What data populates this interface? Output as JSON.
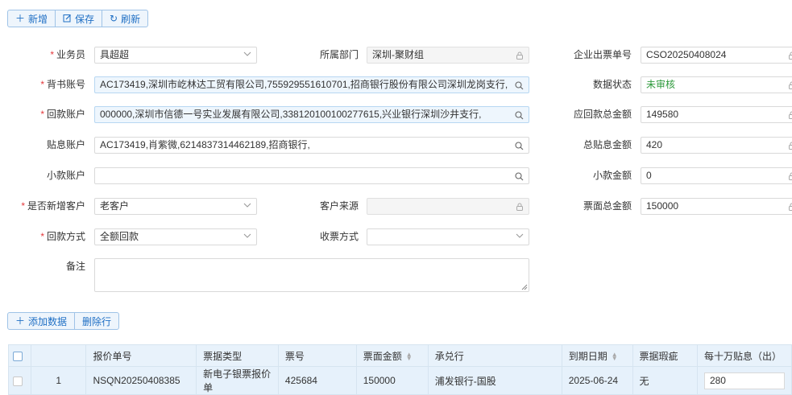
{
  "toolbar": {
    "add": "新增",
    "save": "保存",
    "refresh": "刷新"
  },
  "form": {
    "salesman": {
      "label": "业务员",
      "value": "具超超"
    },
    "department": {
      "label": "所属部门",
      "value": "深圳-聚财组"
    },
    "ticket_no": {
      "label": "企业出票单号",
      "value": "CSO20250408024"
    },
    "endorse_account": {
      "label": "背书账号",
      "value": "AC173419,深圳市屹林达工贸有限公司,755929551610701,招商银行股份有限公司深圳龙岗支行,"
    },
    "data_status": {
      "label": "数据状态",
      "value": "未审核"
    },
    "return_account": {
      "label": "回款账户",
      "value": "000000,深圳市信德一号实业发展有限公司,338120100100277615,兴业银行深圳沙井支行,"
    },
    "receivable_total": {
      "label": "应回款总金额",
      "value": "149580"
    },
    "discount_account": {
      "label": "贴息账户",
      "value": "AC173419,肖紫微,6214837314462189,招商银行,"
    },
    "discount_total": {
      "label": "总贴息金额",
      "value": "420"
    },
    "small_account": {
      "label": "小款账户",
      "value": ""
    },
    "small_amount": {
      "label": "小款金额",
      "value": "0"
    },
    "new_customer": {
      "label": "是否新增客户",
      "value": "老客户"
    },
    "customer_source": {
      "label": "客户来源",
      "value": ""
    },
    "face_total": {
      "label": "票面总金额",
      "value": "150000"
    },
    "return_method": {
      "label": "回款方式",
      "value": "全额回款"
    },
    "receive_method": {
      "label": "收票方式",
      "value": ""
    },
    "remark": {
      "label": "备注",
      "value": ""
    }
  },
  "rows_toolbar": {
    "add": "添加数据",
    "delete": "删除行"
  },
  "table": {
    "headers": [
      "",
      "",
      "报价单号",
      "票据类型",
      "票号",
      "票面金额",
      "承兑行",
      "到期日期",
      "票据瑕疵",
      "每十万贴息（出）"
    ],
    "rows": [
      {
        "index": "1",
        "quote_no": "NSQN20250408385",
        "bill_type": "新电子银票报价单",
        "bill_no": "425684",
        "face_amount": "150000",
        "acceptor": "浦发银行-国股",
        "due_date": "2025-06-24",
        "defect": "无",
        "discount_per_100k": "280"
      }
    ]
  },
  "colors": {
    "accent": "#1f6fc4",
    "required": "#e4393c",
    "status_green": "#2e9a3c"
  }
}
